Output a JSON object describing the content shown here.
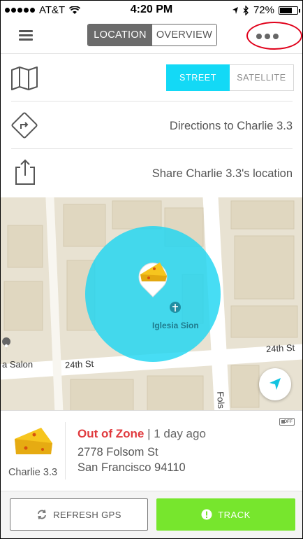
{
  "status_bar": {
    "carrier": "AT&T",
    "time": "4:20 PM",
    "battery": "72%",
    "battery_level": 0.72
  },
  "nav": {
    "tabs": [
      {
        "label": "LOCATION",
        "active": true
      },
      {
        "label": "OVERVIEW",
        "active": false
      }
    ],
    "menu_icon": "hamburger-icon",
    "more_icon": "more-dots-icon",
    "highlight_color": "#e0001a"
  },
  "panel": {
    "map_icon": "map-icon",
    "map_types": [
      {
        "label": "STREET",
        "active": true
      },
      {
        "label": "SATELLITE",
        "active": false
      }
    ],
    "directions_label": "Directions to Charlie 3.3",
    "share_label": "Share Charlie 3.3's location",
    "accent_color": "#13d9f6"
  },
  "map": {
    "streets": [
      "24th St",
      "24th St",
      "Folsom St"
    ],
    "poi": "Iglesia Sion",
    "partial_poi": "a Salon",
    "street_label_folsom": "Fols"
  },
  "device": {
    "name": "Charlie 3.3",
    "status": "Out of Zone",
    "last_seen": "1 day ago",
    "address_line1": "2778 Folsom St",
    "address_line2": "San Francisco 94110",
    "gps_badge": "OFF",
    "avatar": "cheese-icon"
  },
  "actions": {
    "refresh_label": "REFRESH GPS",
    "track_label": "TRACK",
    "track_color": "#77e62d"
  }
}
